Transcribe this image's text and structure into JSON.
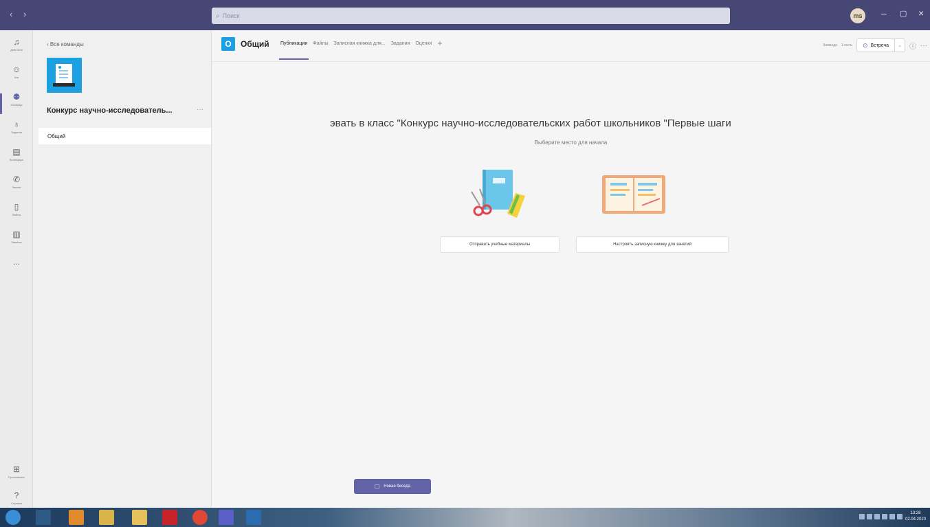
{
  "window": {
    "search_placeholder": "Поиск",
    "avatar_initials": "ms"
  },
  "rail": {
    "items": [
      {
        "label": "Действия",
        "icon": "bell-icon"
      },
      {
        "label": "Чат",
        "icon": "chat-icon"
      },
      {
        "label": "Команды",
        "icon": "teams-icon",
        "active": true
      },
      {
        "label": "Задания",
        "icon": "assignments-icon"
      },
      {
        "label": "Календарь",
        "icon": "calendar-icon"
      },
      {
        "label": "Звонки",
        "icon": "phone-icon"
      },
      {
        "label": "Файлы",
        "icon": "file-icon"
      },
      {
        "label": "Заметки",
        "icon": "notebook-icon"
      },
      {
        "label": "...",
        "icon": "more-icon"
      }
    ],
    "bottom": [
      {
        "label": "Приложения",
        "icon": "apps-icon"
      },
      {
        "label": "Справка",
        "icon": "help-icon"
      }
    ]
  },
  "panel": {
    "back_label": "‹ Все команды",
    "team_name": "Конкурс научно-исследователь...",
    "more": "···",
    "channel": "Общий"
  },
  "header": {
    "channel_initial": "О",
    "channel_title": "Общий",
    "tabs": [
      "Публикации",
      "Файлы",
      "Записная книжка для...",
      "Задания",
      "Оценки"
    ],
    "add_tab": "+",
    "right": {
      "team_btn": "Команда",
      "members": "1 гость",
      "meet_label": "Встреча",
      "meet_split": "⌄",
      "info": "ⓘ",
      "more": "···"
    }
  },
  "welcome": {
    "title": "эвать в класс \"Конкурс научно-исследовательских работ школьников \"Первые шаги",
    "subtitle": "Выберите место для начала",
    "cards": [
      {
        "label": "Отправить учебные материалы"
      },
      {
        "label": "Настроить записную книжку для занятий"
      }
    ]
  },
  "compose": {
    "new_chat": "Новая беседа",
    "icon": "compose-icon"
  },
  "taskbar": {
    "clock_time": "13:28",
    "clock_date": "02.04.2020"
  },
  "colors": {
    "brand": "#6264a7",
    "titlebar": "#464775",
    "team_tile": "#1ba1e2"
  }
}
